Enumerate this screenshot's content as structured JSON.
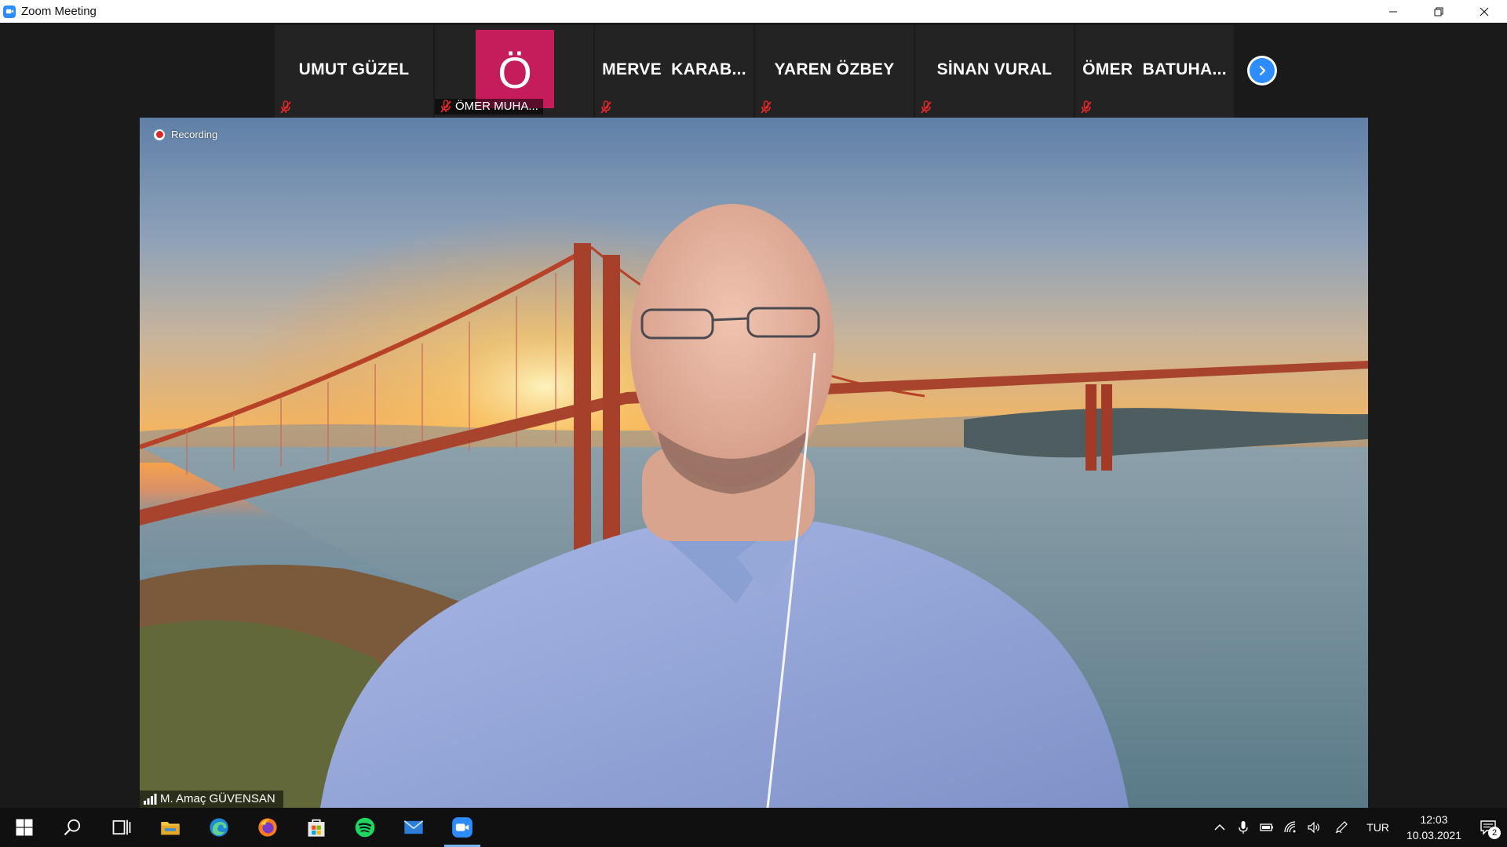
{
  "window": {
    "title": "Zoom Meeting",
    "controls": [
      "minimize-icon",
      "restore-icon",
      "close-icon"
    ]
  },
  "participants": [
    {
      "name": "UMUT GÜZEL",
      "muted": true,
      "video": false
    },
    {
      "name": "ÖMER MUHA...",
      "avatar_letter": "Ö",
      "avatar_color": "#c51d5b",
      "muted": true,
      "video": false
    },
    {
      "name": "MERVE  KARAB...",
      "muted": true,
      "video": false
    },
    {
      "name": "YAREN ÖZBEY",
      "muted": true,
      "video": false
    },
    {
      "name": "SİNAN VURAL",
      "muted": true,
      "video": false
    },
    {
      "name": "ÖMER  BATUHA...",
      "muted": true,
      "video": false
    }
  ],
  "strip": {
    "next_icon": "chevron-right-icon"
  },
  "main_video": {
    "recording_label": "Recording",
    "speaker_name": "M. Amaç GÜVENSAN",
    "background": "golden-gate-bridge-sunset"
  },
  "taskbar": {
    "apps": [
      "windows-start-icon",
      "search-icon",
      "task-view-icon",
      "file-explorer-icon",
      "edge-icon",
      "firefox-icon",
      "store-icon",
      "spotify-icon",
      "mail-icon",
      "zoom-icon"
    ],
    "active_app": "zoom-icon",
    "language": "TUR",
    "time": "12:03",
    "date": "10.03.2021",
    "notification_count": "2"
  },
  "colors": {
    "accent": "#2d8cff",
    "muted_icon": "#e02828",
    "avatar": "#c51d5b"
  }
}
